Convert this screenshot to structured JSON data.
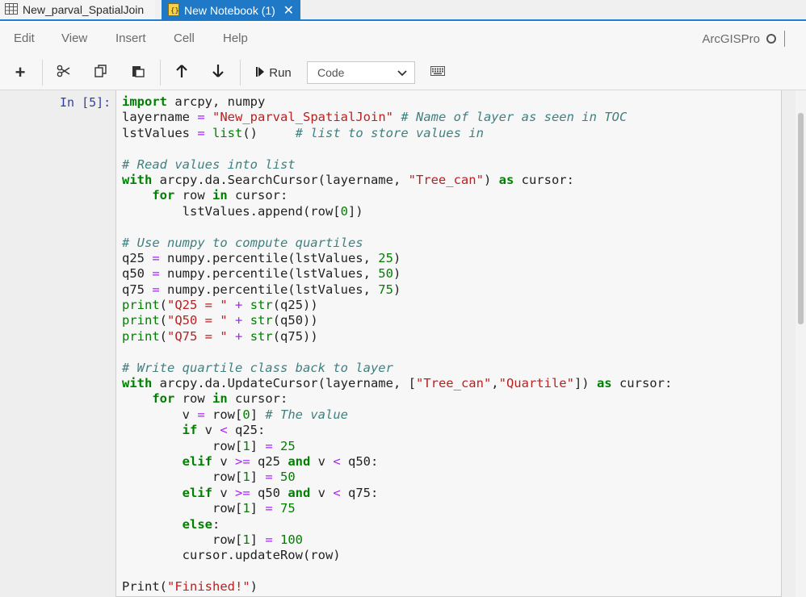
{
  "tabs": [
    {
      "label": "New_parval_SpatialJoin",
      "icon": "table-icon"
    },
    {
      "label": "New Notebook (1)",
      "icon": "notebook-icon",
      "close": "✕"
    }
  ],
  "menu": [
    "Edit",
    "View",
    "Insert",
    "Cell",
    "Help"
  ],
  "kernel": {
    "label": "ArcGISPro"
  },
  "toolbar": {
    "add": "+",
    "run_label": "Run",
    "cell_type": "Code"
  },
  "cell": {
    "prompt": "In [5]:",
    "lines": [
      "import arcpy, numpy",
      "layername = \"New_parval_SpatialJoin\" # Name of layer as seen in TOC",
      "lstValues = list()     # list to store values in",
      "",
      "# Read values into list",
      "with arcpy.da.SearchCursor(layername, \"Tree_can\") as cursor:",
      "    for row in cursor:",
      "        lstValues.append(row[0])",
      "",
      "# Use numpy to compute quartiles",
      "q25 = numpy.percentile(lstValues, 25)",
      "q50 = numpy.percentile(lstValues, 50)",
      "q75 = numpy.percentile(lstValues, 75)",
      "print(\"Q25 = \" + str(q25))",
      "print(\"Q50 = \" + str(q50))",
      "print(\"Q75 = \" + str(q75))",
      "",
      "# Write quartile class back to layer",
      "with arcpy.da.UpdateCursor(layername, [\"Tree_can\",\"Quartile\"]) as cursor:",
      "    for row in cursor:",
      "        v = row[0] # The value",
      "        if v < q25:",
      "            row[1] = 25",
      "        elif v >= q25 and v < q50:",
      "            row[1] = 50",
      "        elif v >= q50 and v < q75:",
      "            row[1] = 75",
      "        else:",
      "            row[1] = 100",
      "        cursor.updateRow(row)",
      "",
      "Print(\"Finished!\")"
    ]
  }
}
